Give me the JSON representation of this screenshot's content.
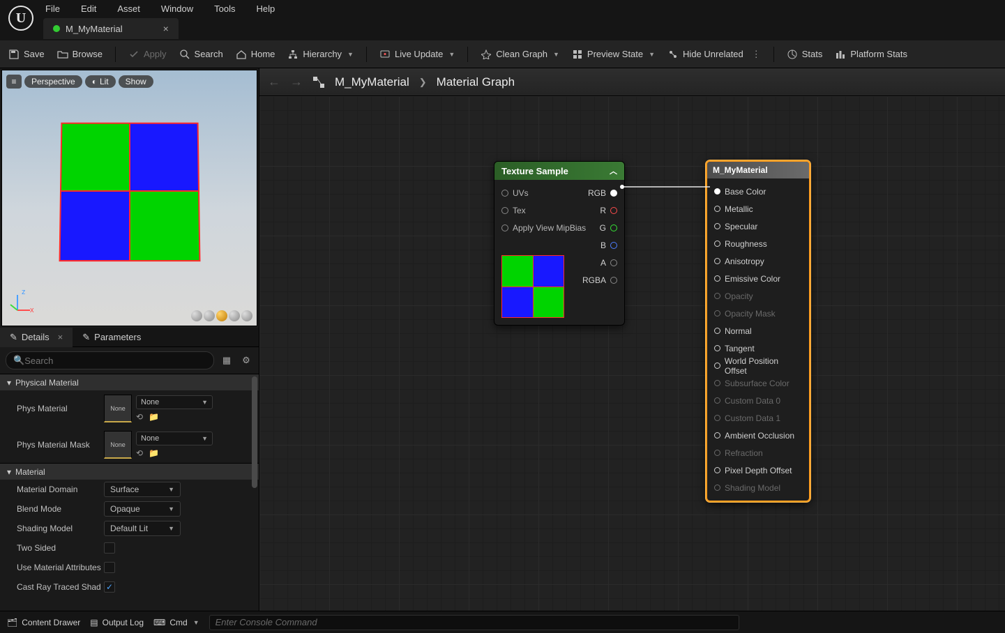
{
  "menu": [
    "File",
    "Edit",
    "Asset",
    "Window",
    "Tools",
    "Help"
  ],
  "tab": {
    "title": "M_MyMaterial"
  },
  "toolbar": {
    "save": "Save",
    "browse": "Browse",
    "apply": "Apply",
    "search": "Search",
    "home": "Home",
    "hierarchy": "Hierarchy",
    "live_update": "Live Update",
    "clean_graph": "Clean Graph",
    "preview_state": "Preview State",
    "hide_unrelated": "Hide Unrelated",
    "stats": "Stats",
    "platform_stats": "Platform Stats"
  },
  "viewport": {
    "pills": [
      "Perspective",
      "Lit",
      "Show"
    ]
  },
  "panels": {
    "details": "Details",
    "parameters": "Parameters",
    "search_ph": "Search"
  },
  "sections": {
    "physmat": "Physical Material",
    "material": "Material"
  },
  "props": {
    "phys_material": "Phys Material",
    "phys_material_mask": "Phys Material Mask",
    "none": "None",
    "material_domain": "Material Domain",
    "material_domain_v": "Surface",
    "blend_mode": "Blend Mode",
    "blend_mode_v": "Opaque",
    "shading_model": "Shading Model",
    "shading_model_v": "Default Lit",
    "two_sided": "Two Sided",
    "use_mat_attrs": "Use Material Attributes",
    "cast_ray": "Cast Ray Traced Shad"
  },
  "breadcrumb": {
    "root": "M_MyMaterial",
    "page": "Material Graph"
  },
  "node_ts": {
    "title": "Texture Sample",
    "in": [
      "UVs",
      "Tex",
      "Apply View MipBias"
    ],
    "out": [
      "RGB",
      "R",
      "G",
      "B",
      "A",
      "RGBA"
    ]
  },
  "node_mat": {
    "title": "M_MyMaterial",
    "pins": [
      {
        "label": "Base Color",
        "enabled": true,
        "filled": true
      },
      {
        "label": "Metallic",
        "enabled": true
      },
      {
        "label": "Specular",
        "enabled": true
      },
      {
        "label": "Roughness",
        "enabled": true
      },
      {
        "label": "Anisotropy",
        "enabled": true
      },
      {
        "label": "Emissive Color",
        "enabled": true
      },
      {
        "label": "Opacity",
        "enabled": false
      },
      {
        "label": "Opacity Mask",
        "enabled": false
      },
      {
        "label": "Normal",
        "enabled": true
      },
      {
        "label": "Tangent",
        "enabled": true
      },
      {
        "label": "World Position Offset",
        "enabled": true
      },
      {
        "label": "Subsurface Color",
        "enabled": false
      },
      {
        "label": "Custom Data 0",
        "enabled": false
      },
      {
        "label": "Custom Data 1",
        "enabled": false
      },
      {
        "label": "Ambient Occlusion",
        "enabled": true
      },
      {
        "label": "Refraction",
        "enabled": false
      },
      {
        "label": "Pixel Depth Offset",
        "enabled": true
      },
      {
        "label": "Shading Model",
        "enabled": false
      }
    ]
  },
  "bottom": {
    "content_drawer": "Content Drawer",
    "output_log": "Output Log",
    "cmd": "Cmd",
    "cmd_ph": "Enter Console Command"
  }
}
